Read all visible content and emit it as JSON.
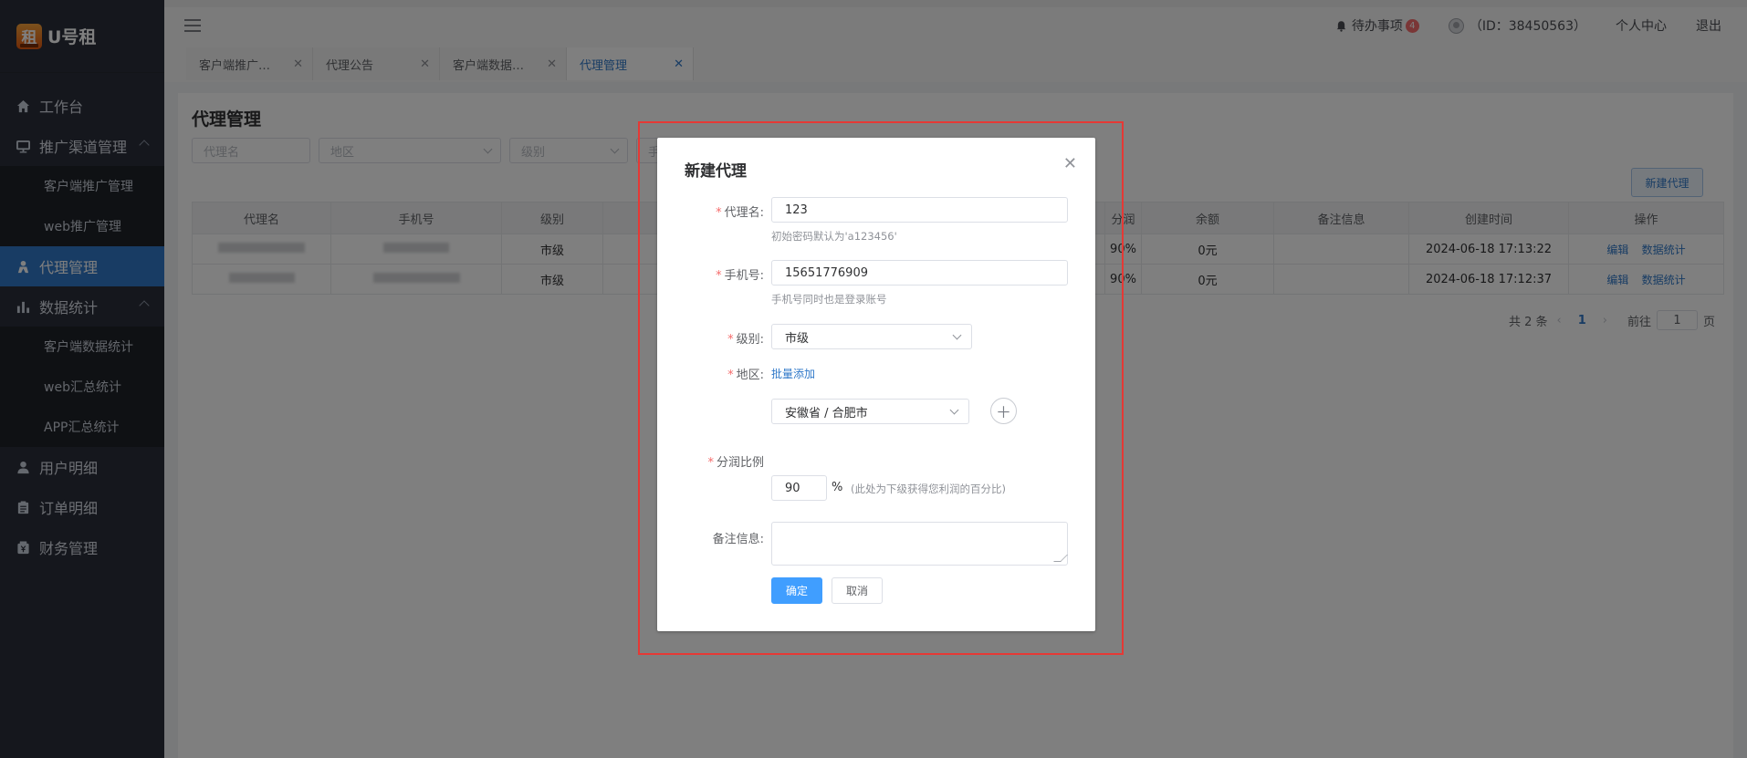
{
  "app": {
    "name": "U号租",
    "logo_char": "租"
  },
  "sidebar": {
    "items": [
      {
        "label": "工作台",
        "icon": "home-icon"
      },
      {
        "label": "推广渠道管理",
        "icon": "monitor-icon",
        "expanded": true,
        "children": [
          {
            "label": "客户端推广管理"
          },
          {
            "label": "web推广管理"
          }
        ]
      },
      {
        "label": "代理管理",
        "icon": "agent-icon",
        "active": true
      },
      {
        "label": "数据统计",
        "icon": "bar-chart-icon",
        "expanded": true,
        "children": [
          {
            "label": "客户端数据统计"
          },
          {
            "label": "web汇总统计"
          },
          {
            "label": "APP汇总统计"
          }
        ]
      },
      {
        "label": "用户明细",
        "icon": "user-icon"
      },
      {
        "label": "订单明细",
        "icon": "clipboard-icon"
      },
      {
        "label": "财务管理",
        "icon": "finance-icon"
      }
    ]
  },
  "topbar": {
    "todo_label": "待办事项",
    "todo_count": "4",
    "user_id": "（ID：38450563）",
    "profile_label": "个人中心",
    "logout_label": "退出"
  },
  "tabs": [
    {
      "label": "客户端推广…",
      "active": false
    },
    {
      "label": "代理公告",
      "active": false
    },
    {
      "label": "客户端数据…",
      "active": false
    },
    {
      "label": "代理管理",
      "active": true
    }
  ],
  "page": {
    "title": "代理管理",
    "filters": {
      "agent_name_placeholder": "代理名",
      "region_placeholder": "地区",
      "level_placeholder": "级别",
      "phone_placeholder": "手"
    },
    "new_button": "新建代理",
    "table": {
      "columns": [
        "代理名",
        "手机号",
        "级别",
        "",
        "分润",
        "余额",
        "备注信息",
        "创建时间",
        "操作"
      ],
      "rows": [
        {
          "name": "",
          "phone": "",
          "level": "市级",
          "share": "90%",
          "balance": "0元",
          "remark": "",
          "created": "2024-06-18 17:13:22",
          "ops": [
            "编辑",
            "数据统计"
          ]
        },
        {
          "name": "",
          "phone": "",
          "level": "市级",
          "share": "90%",
          "balance": "0元",
          "remark": "",
          "created": "2024-06-18 17:12:37",
          "ops": [
            "编辑",
            "数据统计"
          ]
        }
      ]
    },
    "pagination": {
      "total": "共 2 条",
      "current": "1",
      "goto_label": "前往",
      "goto_value": "1",
      "page_suffix": "页"
    }
  },
  "modal": {
    "title": "新建代理",
    "fields": {
      "agent_name": {
        "label": "代理名:",
        "value": "123",
        "hint": "初始密码默认为'a123456'"
      },
      "phone": {
        "label": "手机号:",
        "value": "15651776909",
        "hint": "手机号同时也是登录账号"
      },
      "level": {
        "label": "级别:",
        "value": "市级"
      },
      "region": {
        "label": "地区:",
        "batch_link": "批量添加",
        "value": "安徽省 / 合肥市"
      },
      "share_ratio": {
        "label": "分润比例",
        "value": "90",
        "unit": "%",
        "note": "(此处为下级获得您利润的百分比)"
      },
      "remark": {
        "label": "备注信息:",
        "value": ""
      }
    },
    "confirm_button": "确定",
    "cancel_button": "取消"
  }
}
